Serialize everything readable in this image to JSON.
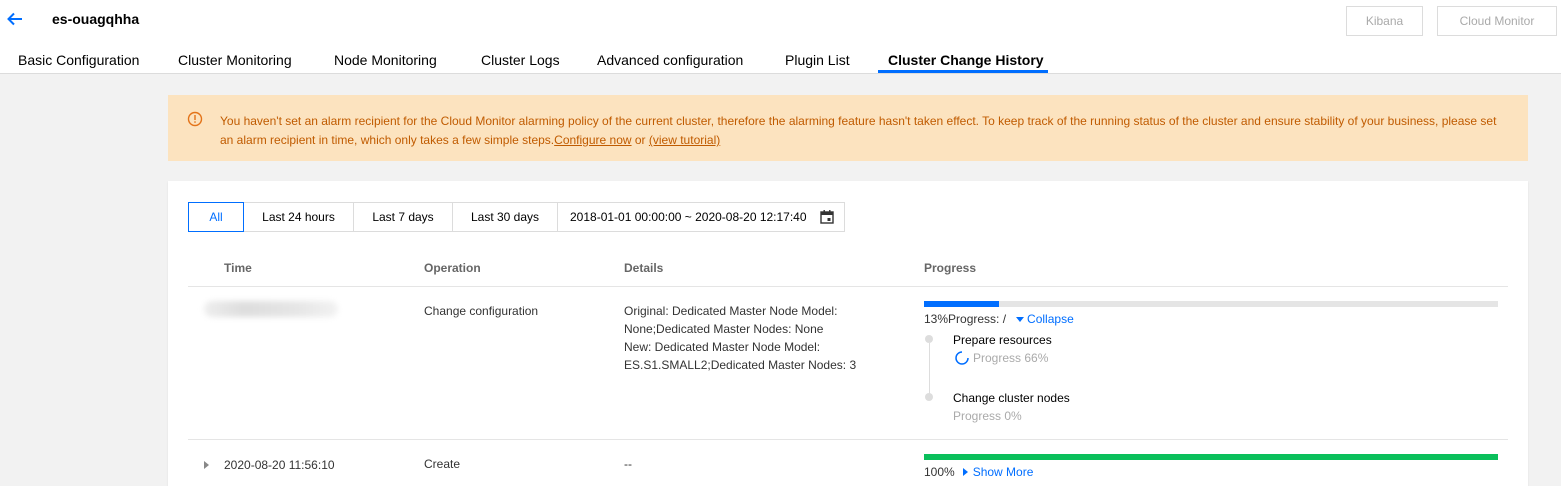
{
  "header": {
    "title": "es-ouagqhha",
    "kibana_label": "Kibana",
    "cloud_monitor_label": "Cloud Monitor"
  },
  "tabs": [
    {
      "label": "Basic Configuration"
    },
    {
      "label": "Cluster Monitoring"
    },
    {
      "label": "Node Monitoring"
    },
    {
      "label": "Cluster Logs"
    },
    {
      "label": "Advanced configuration"
    },
    {
      "label": "Plugin List"
    },
    {
      "label": "Cluster Change History",
      "active": true
    }
  ],
  "alert": {
    "text": "You haven't set an alarm recipient for the Cloud Monitor alarming policy of the current cluster, therefore the alarming feature hasn't taken effect. To keep track of the running status of the cluster and ensure stability of your business, please set an alarm recipient in time, which only takes a few simple steps.",
    "configure_link": "Configure now",
    "or_text": " or ",
    "tutorial_link": "(view tutorial)"
  },
  "filters": {
    "all": "All",
    "last24": "Last 24 hours",
    "last7": "Last 7 days",
    "last30": "Last 30 days",
    "date_range": "2018-01-01 00:00:00 ~ 2020-08-20 12:17:40"
  },
  "table": {
    "headers": {
      "time": "Time",
      "operation": "Operation",
      "details": "Details",
      "progress": "Progress"
    },
    "rows": [
      {
        "time": "",
        "operation": "Change configuration",
        "details": [
          "Original: Dedicated Master Node Model:",
          "None;Dedicated Master Nodes: None",
          "New: Dedicated Master Node Model:",
          "ES.S1.SMALL2;Dedicated Master Nodes: 3"
        ],
        "progress_percent": 13,
        "progress_label": "13%Progress: /",
        "toggle_label": "Collapse",
        "steps": [
          {
            "title": "Prepare resources",
            "sub": "Progress 66%"
          },
          {
            "title": "Change cluster nodes",
            "sub": "Progress 0%"
          }
        ]
      },
      {
        "time": "2020-08-20 11:56:10",
        "operation": "Create",
        "details": [
          "--"
        ],
        "progress_percent": 100,
        "progress_label": "100%",
        "toggle_label": "Show More"
      }
    ]
  },
  "colors": {
    "accent": "#006eff",
    "progress_in_progress": "#006eff",
    "progress_done": "#0abf5b",
    "alert_bg": "#fce3bf",
    "alert_text": "#c05b00"
  }
}
